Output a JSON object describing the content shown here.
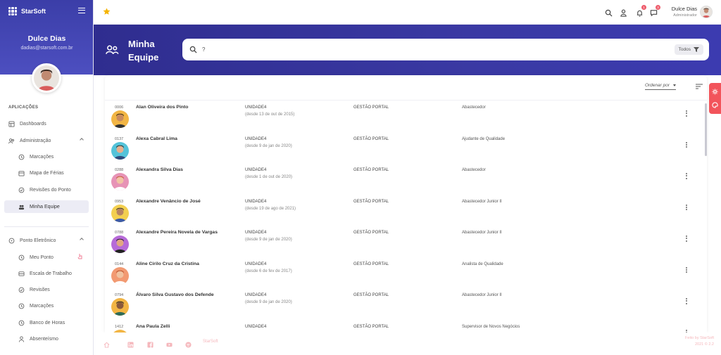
{
  "app": {
    "brand": "StarSoft"
  },
  "user": {
    "name": "Dulce Dias",
    "email": "dadias@starsoft.com.br",
    "role": "Administrador"
  },
  "sidebar": {
    "section_label": "APLICAÇÕES",
    "items": [
      {
        "label": "Dashboards",
        "icon": "dashboard-icon"
      },
      {
        "label": "Administração",
        "icon": "users-icon",
        "expanded": true
      },
      {
        "label": "Marcações",
        "icon": "clock-icon"
      },
      {
        "label": "Mapa de Férias",
        "icon": "calendar-icon"
      },
      {
        "label": "Revisões do Ponto",
        "icon": "check-circle-icon"
      },
      {
        "label": "Minha Equipe",
        "icon": "team-icon",
        "active": true
      },
      {
        "label": "Ponto Eletrônico",
        "icon": "timer-icon",
        "expanded": true
      },
      {
        "label": "Meu Ponto",
        "icon": "clock-icon"
      },
      {
        "label": "Escala de Trabalho",
        "icon": "grid-icon"
      },
      {
        "label": "Revisões",
        "icon": "check-circle-icon"
      },
      {
        "label": "Marcações",
        "icon": "clock-icon"
      },
      {
        "label": "Banco de Horas",
        "icon": "clock-icon"
      },
      {
        "label": "Absenteísmo",
        "icon": "person-icon"
      }
    ]
  },
  "topbar": {
    "notification_count": "1",
    "message_count": "3"
  },
  "page": {
    "title": "Minha Equipe",
    "search": {
      "value": "?",
      "placeholder": ""
    },
    "filter_label": "Todos",
    "sort_label": "Ordenar por"
  },
  "team": [
    {
      "code": "0006",
      "name": "Alan Oliveira dos Pinto",
      "unit": "UNIDADE4",
      "since": "(desde 13 de out de 2015)",
      "dept": "GESTÃO PORTAL",
      "role": "Abastecedor"
    },
    {
      "code": "0137",
      "name": "Alexa Cabral Lima",
      "unit": "UNIDADE4",
      "since": "(desde 9 de jan de 2020)",
      "dept": "GESTÃO PORTAL",
      "role": "Ajudante de Qualidade"
    },
    {
      "code": "0288",
      "name": "Alexandra Silva Dias",
      "unit": "UNIDADE4",
      "since": "(desde 1 de out de 2020)",
      "dept": "GESTÃO PORTAL",
      "role": "Abastecedor"
    },
    {
      "code": "0953",
      "name": "Alexandre Venâncio de José",
      "unit": "UNIDADE4",
      "since": "(desde 19 de ago de 2021)",
      "dept": "GESTÃO PORTAL",
      "role": "Abastecedor Junior II"
    },
    {
      "code": "0788",
      "name": "Alexandre Pereira Novela de Vargas",
      "unit": "UNIDADE4",
      "since": "(desde 9 de jan de 2020)",
      "dept": "GESTÃO PORTAL",
      "role": "Abastecedor Junior II"
    },
    {
      "code": "0144",
      "name": "Aline Cirilo Cruz da Cristina",
      "unit": "UNIDADE4",
      "since": "(desde 6 de fev de 2017)",
      "dept": "GESTÃO PORTAL",
      "role": "Analista de Qualidade"
    },
    {
      "code": "0794",
      "name": "Álvaro Silva Gustavo dos Defende",
      "unit": "UNIDADE4",
      "since": "(desde 9 de jan de 2020)",
      "dept": "GESTÃO PORTAL",
      "role": "Abastecedor Junior II"
    },
    {
      "code": "1412",
      "name": "Ana Paula Zelli",
      "unit": "UNIDADE4",
      "since": "",
      "dept": "GESTÃO PORTAL",
      "role": "Supervisor de Novos Negócios"
    }
  ],
  "footer": {
    "brand": "StarSoft",
    "right_line1": "Feito by StarSoft",
    "right_line2": "2021 © 2.2"
  },
  "colors": {
    "primary": "#3a39a3",
    "accent": "#f2545b",
    "star": "#f5b400"
  }
}
